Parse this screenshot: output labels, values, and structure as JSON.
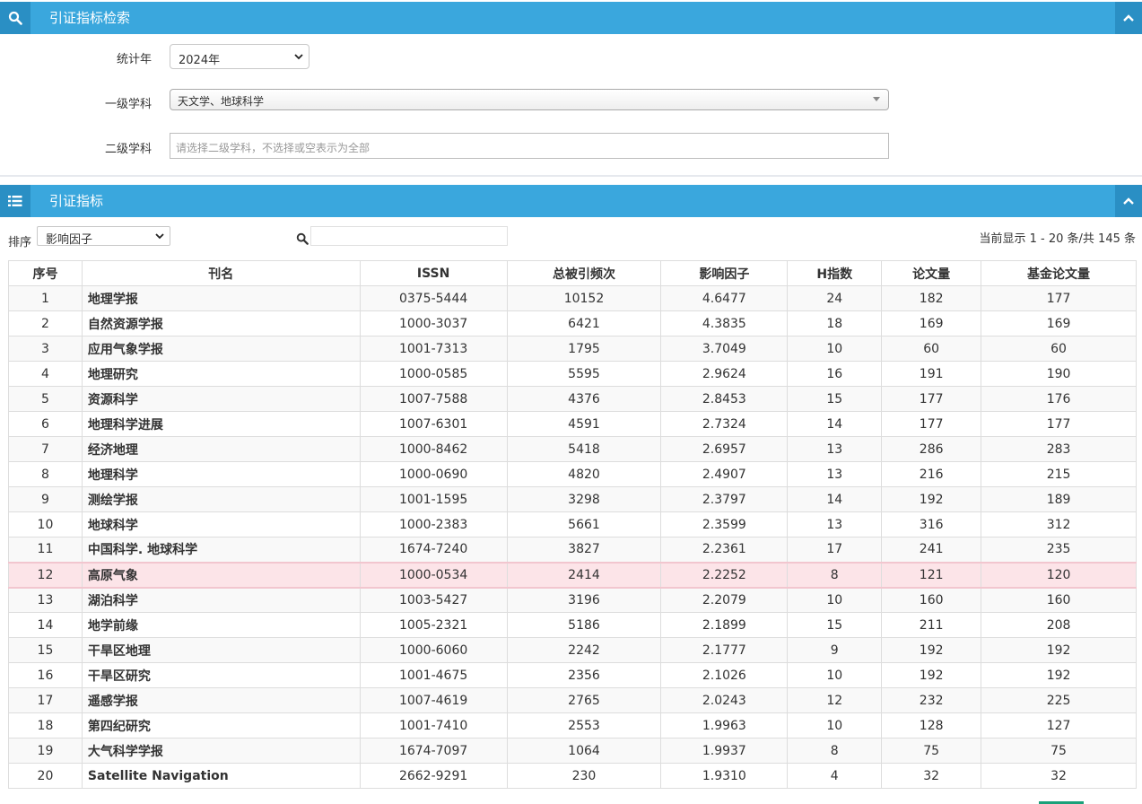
{
  "search_panel": {
    "title": "引证指标检索",
    "year_label": "统计年",
    "year_value": "2024年",
    "level1_label": "一级学科",
    "level1_value": "天文学、地球科学",
    "level2_label": "二级学科",
    "level2_placeholder": "请选择二级学科，不选择或空表示为全部"
  },
  "index_panel": {
    "title": "引证指标",
    "sort_label": "排序",
    "sort_value": "影响因子",
    "search_value": "",
    "display_info": "当前显示 1 - 20 条/共 145 条"
  },
  "table": {
    "headers": [
      "序号",
      "刊名",
      "ISSN",
      "总被引频次",
      "影响因子",
      "H指数",
      "论文量",
      "基金论文量"
    ],
    "rows": [
      {
        "no": "1",
        "name": "地理学报",
        "issn": "0375-5444",
        "cites": "10152",
        "if": "4.6477",
        "h": "24",
        "papers": "182",
        "funded": "177"
      },
      {
        "no": "2",
        "name": "自然资源学报",
        "issn": "1000-3037",
        "cites": "6421",
        "if": "4.3835",
        "h": "18",
        "papers": "169",
        "funded": "169"
      },
      {
        "no": "3",
        "name": "应用气象学报",
        "issn": "1001-7313",
        "cites": "1795",
        "if": "3.7049",
        "h": "10",
        "papers": "60",
        "funded": "60"
      },
      {
        "no": "4",
        "name": "地理研究",
        "issn": "1000-0585",
        "cites": "5595",
        "if": "2.9624",
        "h": "16",
        "papers": "191",
        "funded": "190"
      },
      {
        "no": "5",
        "name": "资源科学",
        "issn": "1007-7588",
        "cites": "4376",
        "if": "2.8453",
        "h": "15",
        "papers": "177",
        "funded": "176"
      },
      {
        "no": "6",
        "name": "地理科学进展",
        "issn": "1007-6301",
        "cites": "4591",
        "if": "2.7324",
        "h": "14",
        "papers": "177",
        "funded": "177"
      },
      {
        "no": "7",
        "name": "经济地理",
        "issn": "1000-8462",
        "cites": "5418",
        "if": "2.6957",
        "h": "13",
        "papers": "286",
        "funded": "283"
      },
      {
        "no": "8",
        "name": "地理科学",
        "issn": "1000-0690",
        "cites": "4820",
        "if": "2.4907",
        "h": "13",
        "papers": "216",
        "funded": "215"
      },
      {
        "no": "9",
        "name": "测绘学报",
        "issn": "1001-1595",
        "cites": "3298",
        "if": "2.3797",
        "h": "14",
        "papers": "192",
        "funded": "189"
      },
      {
        "no": "10",
        "name": "地球科学",
        "issn": "1000-2383",
        "cites": "5661",
        "if": "2.3599",
        "h": "13",
        "papers": "316",
        "funded": "312"
      },
      {
        "no": "11",
        "name": "中国科学. 地球科学",
        "issn": "1674-7240",
        "cites": "3827",
        "if": "2.2361",
        "h": "17",
        "papers": "241",
        "funded": "235"
      },
      {
        "no": "12",
        "name": "高原气象",
        "issn": "1000-0534",
        "cites": "2414",
        "if": "2.2252",
        "h": "8",
        "papers": "121",
        "funded": "120"
      },
      {
        "no": "13",
        "name": "湖泊科学",
        "issn": "1003-5427",
        "cites": "3196",
        "if": "2.2079",
        "h": "10",
        "papers": "160",
        "funded": "160"
      },
      {
        "no": "14",
        "name": "地学前缘",
        "issn": "1005-2321",
        "cites": "5186",
        "if": "2.1899",
        "h": "15",
        "papers": "211",
        "funded": "208"
      },
      {
        "no": "15",
        "name": "干旱区地理",
        "issn": "1000-6060",
        "cites": "2242",
        "if": "2.1777",
        "h": "9",
        "papers": "192",
        "funded": "192"
      },
      {
        "no": "16",
        "name": "干旱区研究",
        "issn": "1001-4675",
        "cites": "2356",
        "if": "2.1026",
        "h": "10",
        "papers": "192",
        "funded": "192"
      },
      {
        "no": "17",
        "name": "遥感学报",
        "issn": "1007-4619",
        "cites": "2765",
        "if": "2.0243",
        "h": "12",
        "papers": "232",
        "funded": "225"
      },
      {
        "no": "18",
        "name": "第四纪研究",
        "issn": "1001-7410",
        "cites": "2553",
        "if": "1.9963",
        "h": "10",
        "papers": "128",
        "funded": "127"
      },
      {
        "no": "19",
        "name": "大气科学学报",
        "issn": "1674-7097",
        "cites": "1064",
        "if": "1.9937",
        "h": "8",
        "papers": "75",
        "funded": "75"
      },
      {
        "no": "20",
        "name": "Satellite Navigation",
        "issn": "2662-9291",
        "cites": "230",
        "if": "1.9310",
        "h": "4",
        "papers": "32",
        "funded": "32"
      }
    ],
    "highlight_row": 12
  },
  "colors": {
    "header_bar": "#3aa7dd",
    "header_icon_bg": "#2a8fc4",
    "highlight_row": "#fce4e8"
  },
  "icons": {
    "search_panel_icon": "search-icon",
    "index_panel_icon": "list-icon",
    "collapse_icon": "chevron-up-icon"
  }
}
